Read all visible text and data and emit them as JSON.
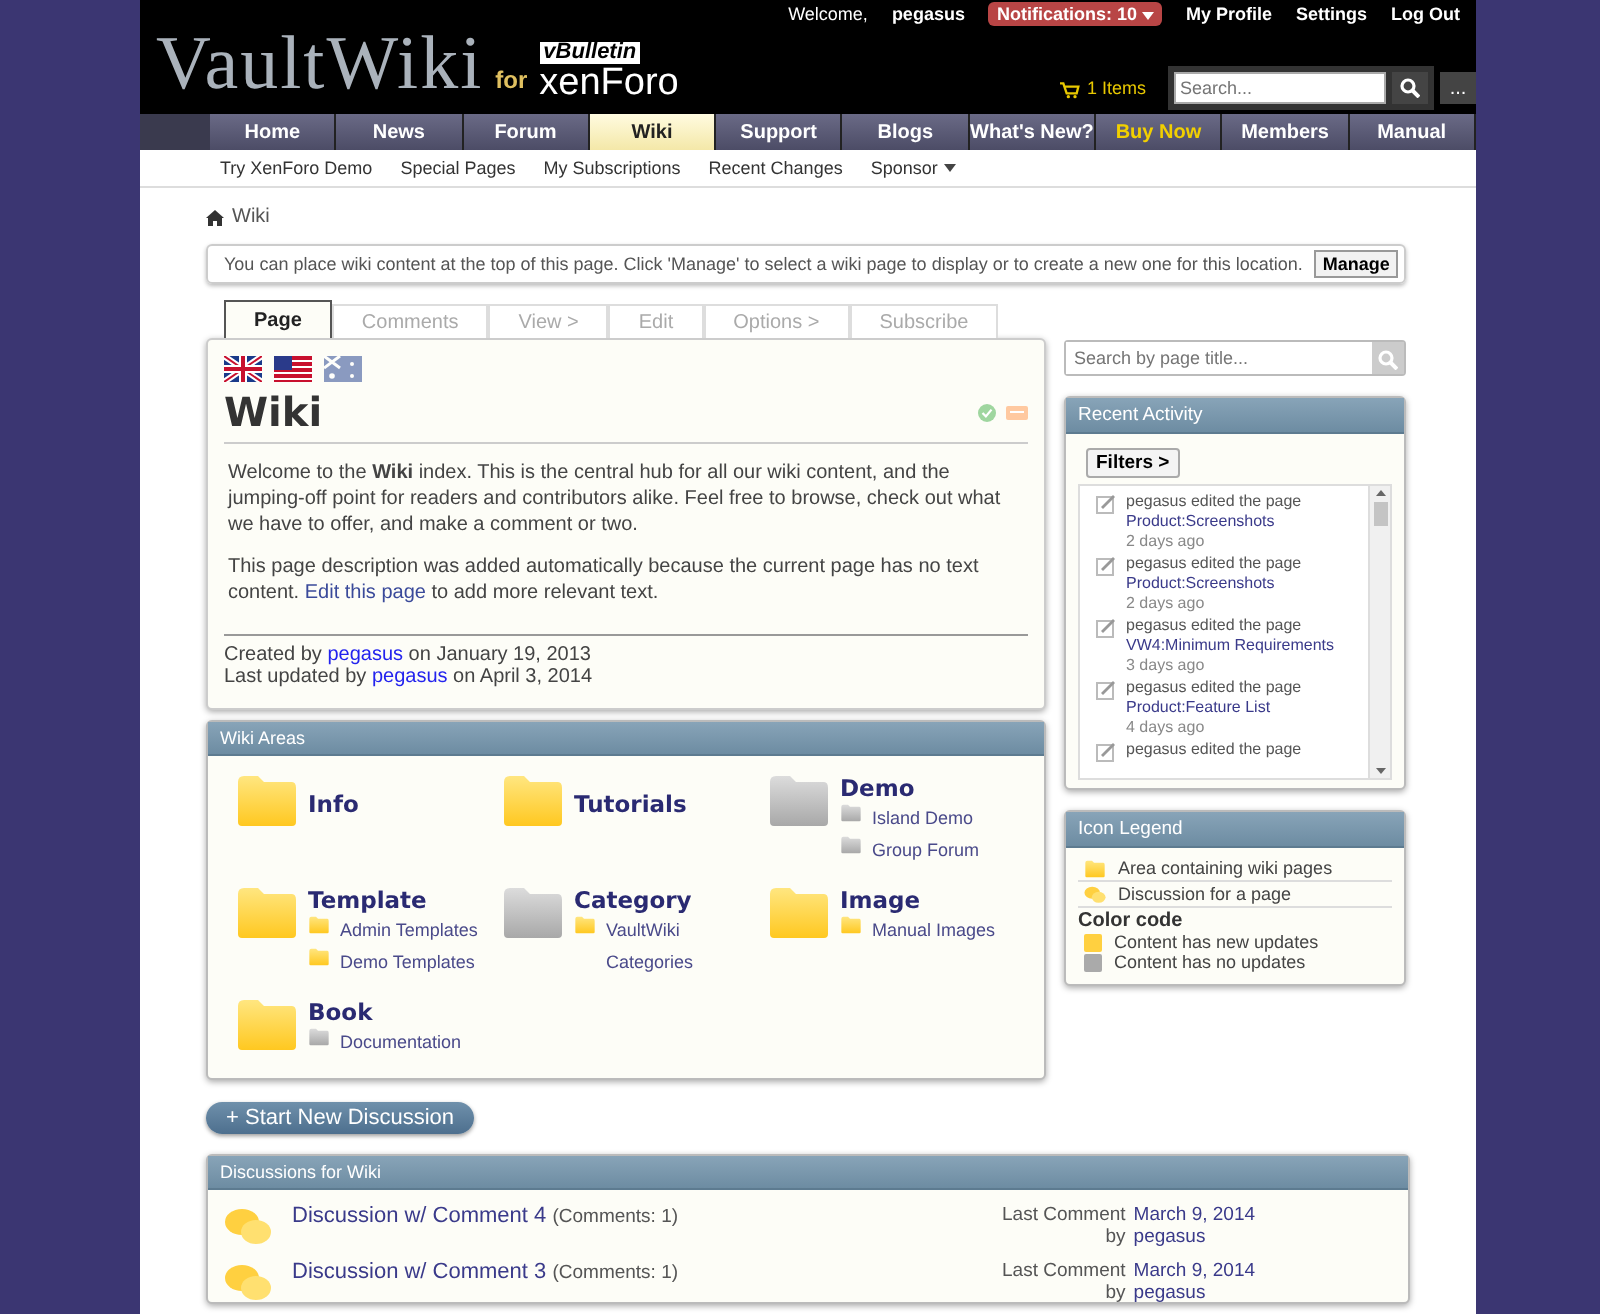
{
  "header": {
    "logo": "VaultWiki",
    "logo_for": "for",
    "partner_top": "vBulletin",
    "partner_bottom": "xenForo",
    "welcome": "Welcome,",
    "username": "pegasus",
    "notifications": "Notifications: 10",
    "links": [
      "My Profile",
      "Settings",
      "Log Out"
    ],
    "cart": "1 Items",
    "search_placeholder": "Search...",
    "more": "..."
  },
  "nav_tabs": [
    {
      "label": "Home",
      "selected": false,
      "kind": "normal"
    },
    {
      "label": "News",
      "selected": false,
      "kind": "normal"
    },
    {
      "label": "Forum",
      "selected": false,
      "kind": "normal"
    },
    {
      "label": "Wiki",
      "selected": true,
      "kind": "normal"
    },
    {
      "label": "Support",
      "selected": false,
      "kind": "normal"
    },
    {
      "label": "Blogs",
      "selected": false,
      "kind": "normal"
    },
    {
      "label": "What's New?",
      "selected": false,
      "kind": "normal"
    },
    {
      "label": "Buy Now",
      "selected": false,
      "kind": "promo"
    },
    {
      "label": "Members",
      "selected": false,
      "kind": "normal"
    },
    {
      "label": "Manual",
      "selected": false,
      "kind": "normal"
    }
  ],
  "sub_nav": [
    {
      "label": "Try XenForo Demo",
      "has_menu": false
    },
    {
      "label": "Special Pages",
      "has_menu": false
    },
    {
      "label": "My Subscriptions",
      "has_menu": false
    },
    {
      "label": "Recent Changes",
      "has_menu": false
    },
    {
      "label": "Sponsor",
      "has_menu": true
    }
  ],
  "breadcrumb": "Wiki",
  "notice": {
    "text": "You can place wiki content at the top of this page. Click 'Manage' to select a wiki page to display or to create a new one for this location.",
    "button": "Manage"
  },
  "page_tabs": [
    {
      "label": "Page",
      "selected": true
    },
    {
      "label": "Comments",
      "selected": false
    },
    {
      "label": "View >",
      "selected": false
    },
    {
      "label": "Edit",
      "selected": false
    },
    {
      "label": "Options >",
      "selected": false
    },
    {
      "label": "Subscribe",
      "selected": false
    }
  ],
  "article": {
    "title": "Wiki",
    "intro": "Welcome to the **Wiki** index. This is the central hub for all our wiki content, and the jumping-off point for readers and contributors alike. Feel free to browse, check out what we have to offer, and make a comment or two.",
    "note": "This page description was added automatically because the current page has no text content.",
    "note_link": "Edit this page",
    "note_after": "to add more relevant text.",
    "credits": [
      {
        "prefix": "Created by",
        "user": "pegasus",
        "suffix": "on January 19, 2013"
      },
      {
        "prefix": "Last updated by",
        "user": "pegasus",
        "suffix": "on April 3, 2014"
      }
    ]
  },
  "wiki_areas": {
    "title": "Wiki Areas",
    "areas": [
      {
        "name": "Info",
        "updated": true
      },
      {
        "name": "Tutorials",
        "updated": true
      },
      {
        "name": "Demo",
        "updated": false,
        "children": [
          {
            "name": "Island Demo",
            "updated": false
          },
          {
            "name": "Group Forum",
            "updated": false
          }
        ]
      },
      {
        "name": "Template",
        "updated": true,
        "children": [
          {
            "name": "Admin Templates",
            "updated": true
          },
          {
            "name": "Demo Templates",
            "updated": true
          }
        ]
      },
      {
        "name": "Category",
        "updated": false,
        "children": [
          {
            "name": "VaultWiki Categories",
            "updated": true
          }
        ]
      },
      {
        "name": "Image",
        "updated": true,
        "children": [
          {
            "name": "Manual Images",
            "updated": true
          }
        ]
      },
      {
        "name": "Book",
        "updated": true,
        "children": [
          {
            "name": "Documentation",
            "updated": false
          }
        ]
      }
    ]
  },
  "start_button": "+ Start New Discussion",
  "discussions": {
    "title": "Discussions for Wiki",
    "items": [
      {
        "title": "Discussion w/ Comment 4",
        "count": "(Comments: 1)",
        "last_label": "Last Comment",
        "date": "March 9, 2014",
        "by": "by",
        "user": "pegasus"
      },
      {
        "title": "Discussion w/ Comment 3",
        "count": "(Comments: 1)",
        "last_label": "Last Comment",
        "date": "March 9, 2014",
        "by": "by",
        "user": "pegasus"
      }
    ]
  },
  "sidebar": {
    "search_placeholder": "Search by page title...",
    "recent_activity": {
      "title": "Recent Activity",
      "filters": "Filters >",
      "items": [
        {
          "text": "pegasus edited the page",
          "page": "Product:Screenshots",
          "time": "2 days ago"
        },
        {
          "text": "pegasus edited the page",
          "page": "Product:Screenshots",
          "time": "2 days ago"
        },
        {
          "text": "pegasus edited the page",
          "page": "VW4:Minimum Requirements",
          "time": "3 days ago"
        },
        {
          "text": "pegasus edited the page",
          "page": "Product:Feature List",
          "time": "4 days ago"
        },
        {
          "text": "pegasus edited the page"
        }
      ]
    },
    "legend": {
      "title": "Icon Legend",
      "items": [
        {
          "kind": "folder",
          "label": "Area containing wiki pages"
        },
        {
          "kind": "discussion",
          "label": "Discussion for a page"
        }
      ],
      "color_heading": "Color code",
      "colors": [
        {
          "updated": true,
          "label": "Content has new updates"
        },
        {
          "updated": false,
          "label": "Content has no updates"
        }
      ]
    }
  }
}
